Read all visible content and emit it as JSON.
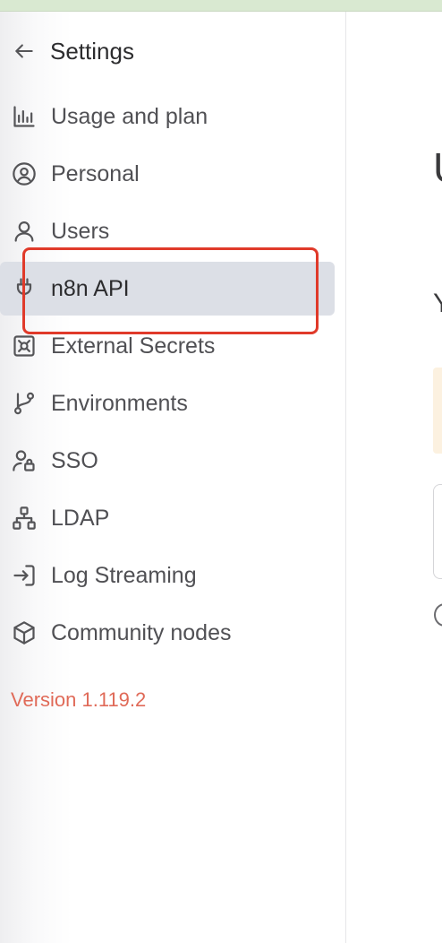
{
  "header": {
    "title": "Settings"
  },
  "nav": {
    "items": [
      {
        "label": "Usage and plan",
        "icon": "chart-bar-icon"
      },
      {
        "label": "Personal",
        "icon": "user-circle-icon"
      },
      {
        "label": "Users",
        "icon": "user-icon"
      },
      {
        "label": "n8n API",
        "icon": "plug-icon",
        "active": true
      },
      {
        "label": "External Secrets",
        "icon": "vault-icon"
      },
      {
        "label": "Environments",
        "icon": "git-branch-icon"
      },
      {
        "label": "SSO",
        "icon": "user-lock-icon"
      },
      {
        "label": "LDAP",
        "icon": "network-icon"
      },
      {
        "label": "Log Streaming",
        "icon": "sign-in-icon"
      },
      {
        "label": "Community nodes",
        "icon": "cube-icon"
      }
    ]
  },
  "version": "Version 1.119.2",
  "main": {
    "heading_fragment": "U",
    "sub_fragment": "Y"
  },
  "colors": {
    "highlight": "#e03a2a",
    "active_bg": "#dcdfe6",
    "version": "#e06a58"
  }
}
